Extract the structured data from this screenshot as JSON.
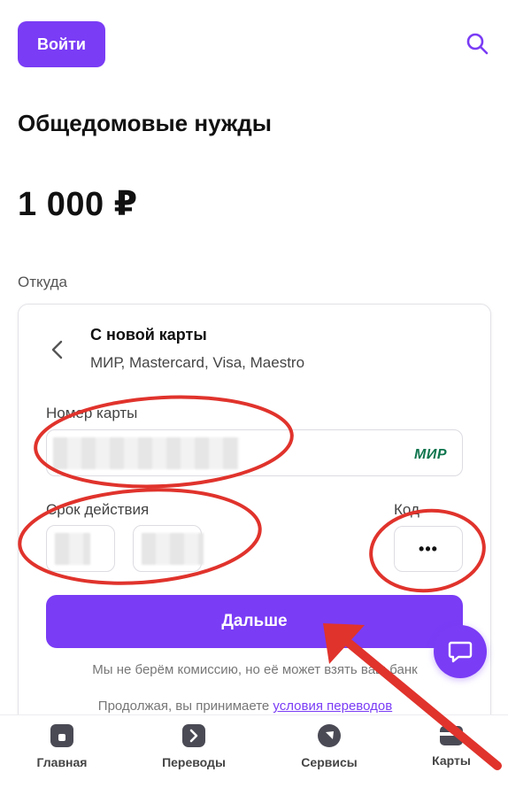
{
  "header": {
    "login_label": "Войти",
    "search_icon": "search-icon"
  },
  "page": {
    "title": "Общедомовые нужды",
    "amount": "1 000 ₽",
    "from_label": "Откуда"
  },
  "payment_source": {
    "title": "С новой карты",
    "subtitle": "МИР, Mastercard, Visa, Maestro",
    "back_icon": "chevron-left-icon"
  },
  "form": {
    "card_number_label": "Номер карты",
    "expiry_label": "Срок действия",
    "cvc_label": "Код",
    "cvc_value": "•••",
    "payment_system": "МИР",
    "next_label": "Дальше"
  },
  "notes": {
    "commission": "Мы не берём комиссию, но её может взять ваш банк",
    "terms_prefix": "Продолжая, вы принимаете ",
    "terms_link": "условия переводов"
  },
  "chat": {
    "icon": "chat-bubble-icon"
  },
  "bottom_nav": {
    "items": [
      {
        "label": "Главная",
        "icon": "home-icon"
      },
      {
        "label": "Переводы",
        "icon": "transfer-icon"
      },
      {
        "label": "Сервисы",
        "icon": "services-icon"
      },
      {
        "label": "Карты",
        "icon": "cards-icon"
      }
    ]
  },
  "colors": {
    "accent": "#7a3cf5",
    "annotation": "#e0332c",
    "mir_green": "#0f754e"
  }
}
